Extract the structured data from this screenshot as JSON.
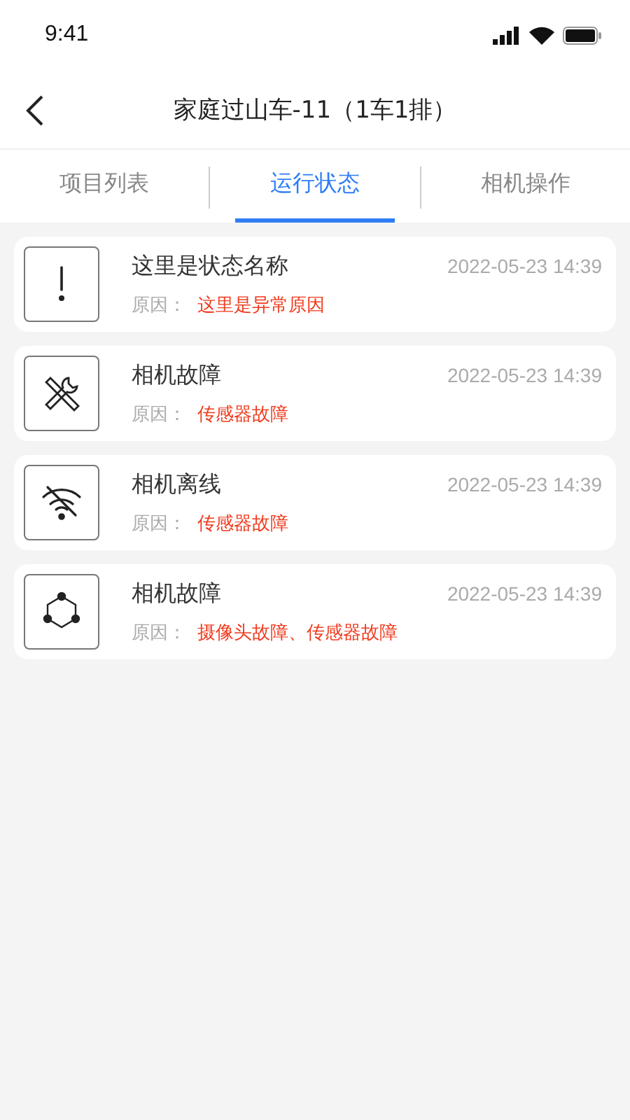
{
  "status_bar": {
    "time": "9:41"
  },
  "header": {
    "title": "家庭过山车-11（1车1排）"
  },
  "tabs": [
    {
      "label": "项目列表",
      "selected": false
    },
    {
      "label": "运行状态",
      "selected": true
    },
    {
      "label": "相机操作",
      "selected": false
    }
  ],
  "items": [
    {
      "kind": "alert",
      "title": "这里是状态名称",
      "time": "2022-05-23 14:39",
      "reason_label": "原因：",
      "reason": "这里是异常原因"
    },
    {
      "kind": "tools",
      "title": "相机故障",
      "time": "2022-05-23 14:39",
      "reason_label": "原因：",
      "reason": "传感器故障"
    },
    {
      "kind": "wifi-off",
      "title": "相机离线",
      "time": "2022-05-23 14:39",
      "reason_label": "原因：",
      "reason": "传感器故障"
    },
    {
      "kind": "nodes",
      "title": "相机故障",
      "time": "2022-05-23 14:39",
      "reason_label": "原因：",
      "reason": "摄像头故障、传感器故障"
    }
  ]
}
